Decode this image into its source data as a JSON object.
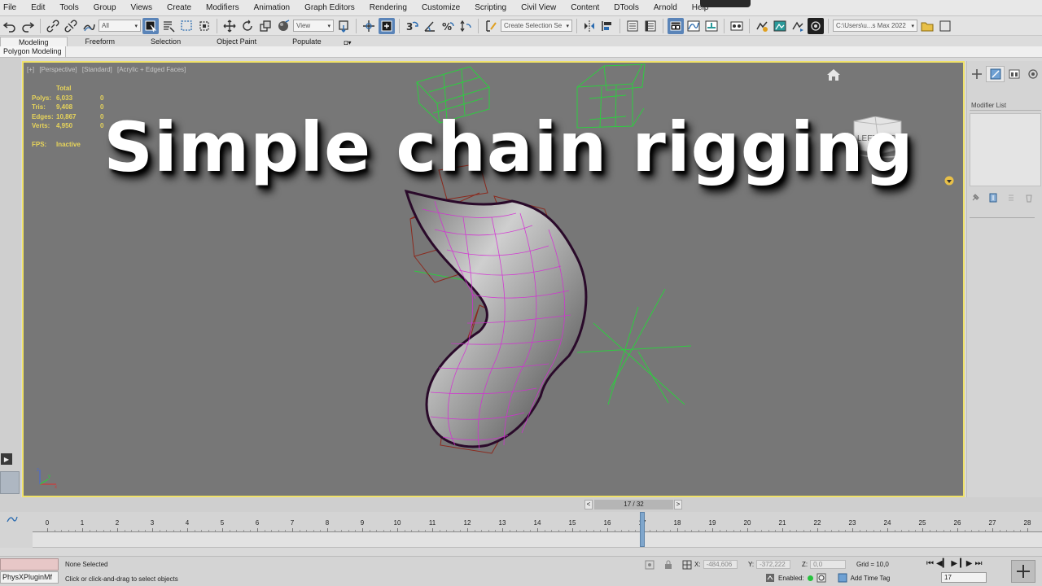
{
  "menu": [
    "File",
    "Edit",
    "Tools",
    "Group",
    "Views",
    "Create",
    "Modifiers",
    "Animation",
    "Graph Editors",
    "Rendering",
    "Customize",
    "Scripting",
    "Civil View",
    "Content",
    "DTools",
    "Arnold",
    "Help"
  ],
  "toolbar": {
    "selection_filter": "All",
    "ref_coord": "View",
    "named_selection": "Create Selection Se",
    "project_path": "C:\\Users\\u...s Max 2022"
  },
  "ribbon": {
    "tabs": [
      "Modeling",
      "Freeform",
      "Selection",
      "Object Paint",
      "Populate"
    ],
    "active_tab": "Modeling",
    "sub_label": "Polygon Modeling"
  },
  "viewport": {
    "labels": [
      "[+]",
      "[Perspective]",
      "[Standard]",
      "[Acrylic + Edged Faces]"
    ],
    "stats": {
      "header": "Total",
      "rows": [
        {
          "key": "Polys:",
          "total": "6,033",
          "sel": "0"
        },
        {
          "key": "Tris:",
          "total": "9,408",
          "sel": "0"
        },
        {
          "key": "Edges:",
          "total": "10,867",
          "sel": "0"
        },
        {
          "key": "Verts:",
          "total": "4,950",
          "sel": "0"
        }
      ],
      "fps_label": "FPS:",
      "fps_value": "Inactive"
    },
    "viewcube_label": "LEFT FRONT"
  },
  "overlay_title": "Simple chain rigging",
  "command_panel": {
    "modifier_list": "Modifier List"
  },
  "time_slider": {
    "position": "17 / 32",
    "prev": "<",
    "next": ">"
  },
  "trackbar": {
    "ticks": [
      "0",
      "1",
      "2",
      "3",
      "4",
      "5",
      "6",
      "7",
      "8",
      "9",
      "10",
      "11",
      "12",
      "13",
      "14",
      "15",
      "16",
      "17",
      "18",
      "19",
      "20",
      "21",
      "22",
      "23",
      "24",
      "25",
      "26",
      "27",
      "28"
    ],
    "current_frame": 17
  },
  "status": {
    "selection": "None Selected",
    "prompt": "Click or click-and-drag to select objects",
    "maxscript_label": "PhysXPluginMf",
    "x_label": "X:",
    "x_value": "-484,606",
    "y_label": "Y:",
    "y_value": "-372,222",
    "z_label": "Z:",
    "z_value": "0,0",
    "grid": "Grid = 10,0",
    "enabled_label": "Enabled:",
    "add_time_tag": "Add Time Tag",
    "frame": "17"
  },
  "colors": {
    "viewport_bg": "#777777",
    "viewport_border": "#f0e26a",
    "stats_text": "#e8d55a",
    "helper_green": "#2ecc40",
    "bone_red": "#8b2a1e",
    "wire_magenta": "#d42dd4"
  }
}
